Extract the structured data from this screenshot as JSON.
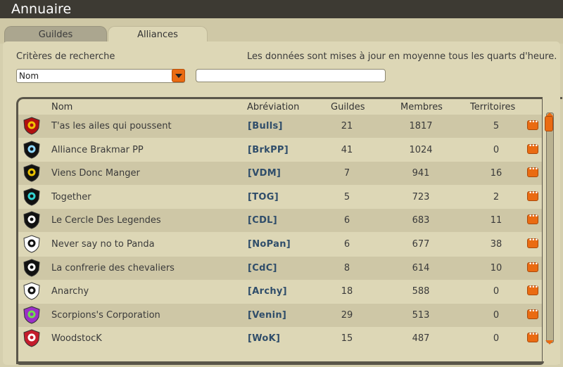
{
  "window": {
    "title": "Annuaire"
  },
  "tabs": [
    {
      "label": "Guildes"
    },
    {
      "label": "Alliances"
    }
  ],
  "search": {
    "criteria_label": "Critères de recherche",
    "update_note": "Les données sont mises à jour en moyenne tous les quarts d'heure.",
    "criteria_selected": "Nom",
    "query_value": ""
  },
  "table": {
    "headers": {
      "name": "Nom",
      "abbr": "Abréviation",
      "guilds": "Guildes",
      "members": "Membres",
      "territories": "Territoires"
    },
    "rows": [
      {
        "name": "T'as les ailes qui poussent",
        "abbr": "[Bulls]",
        "guilds": "21",
        "members": "1817",
        "territories": "5",
        "emblem": "bull-emblem-icon",
        "colors": [
          "#b01010",
          "#f2c200"
        ]
      },
      {
        "name": "Alliance Brakmar PP",
        "abbr": "[BrkPP]",
        "guilds": "41",
        "members": "1024",
        "territories": "0",
        "emblem": "claw-emblem-icon",
        "colors": [
          "#111111",
          "#8fd8ff"
        ]
      },
      {
        "name": "Viens Donc Manger",
        "abbr": "[VDM]",
        "guilds": "7",
        "members": "941",
        "territories": "16",
        "emblem": "sun-emblem-icon",
        "colors": [
          "#111111",
          "#e8c000"
        ]
      },
      {
        "name": "Together",
        "abbr": "[TOG]",
        "guilds": "5",
        "members": "723",
        "territories": "2",
        "emblem": "hourglass-emblem-icon",
        "colors": [
          "#111111",
          "#32d3d3"
        ]
      },
      {
        "name": "Le Cercle Des Legendes",
        "abbr": "[CDL]",
        "guilds": "6",
        "members": "683",
        "territories": "11",
        "emblem": "tree-emblem-icon",
        "colors": [
          "#111111",
          "#ffffff"
        ]
      },
      {
        "name": "Never say no to Panda",
        "abbr": "[NoPan]",
        "guilds": "6",
        "members": "677",
        "territories": "38",
        "emblem": "panda-emblem-icon",
        "colors": [
          "#ffffff",
          "#111111"
        ]
      },
      {
        "name": "La confrerie des chevaliers",
        "abbr": "[CdC]",
        "guilds": "8",
        "members": "614",
        "territories": "10",
        "emblem": "skull-emblem-icon",
        "colors": [
          "#111111",
          "#ffffff"
        ]
      },
      {
        "name": "Anarchy",
        "abbr": "[Archy]",
        "guilds": "18",
        "members": "588",
        "territories": "0",
        "emblem": "skull-crossbones-emblem-icon",
        "colors": [
          "#ffffff",
          "#111111"
        ]
      },
      {
        "name": "Scorpions's Corporation",
        "abbr": "[Venin]",
        "guilds": "29",
        "members": "513",
        "territories": "0",
        "emblem": "scorpion-emblem-icon",
        "colors": [
          "#9b2fc7",
          "#6ee04a"
        ]
      },
      {
        "name": "WoodstocK",
        "abbr": "[WoK]",
        "guilds": "15",
        "members": "487",
        "territories": "0",
        "emblem": "lyre-emblem-icon",
        "colors": [
          "#c41c2c",
          "#ffffff"
        ]
      }
    ]
  },
  "scrollbar": {
    "position": 0
  },
  "accent": "#ea6b12"
}
